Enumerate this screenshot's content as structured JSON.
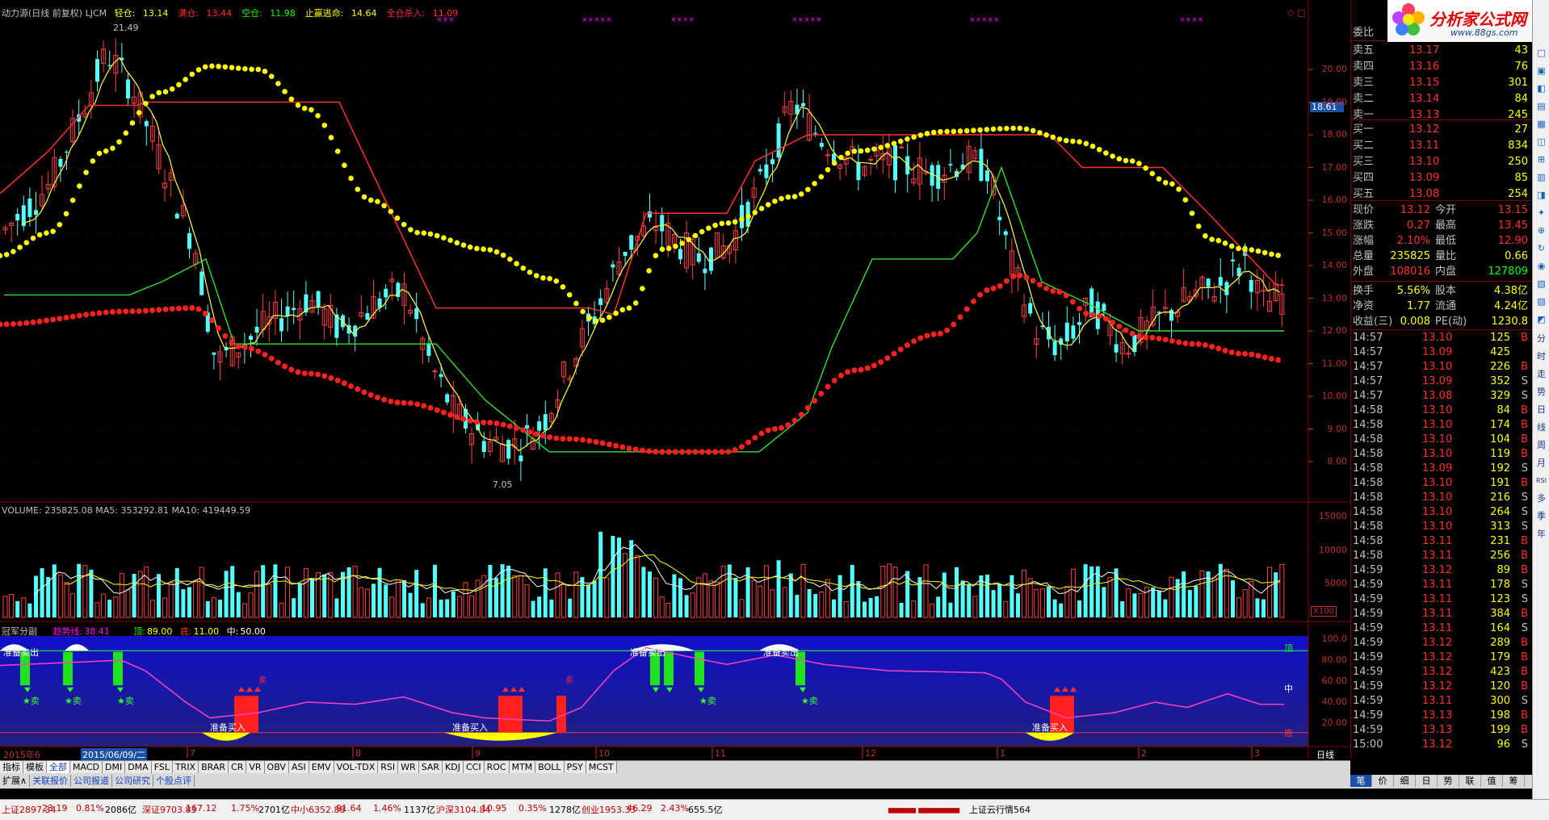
{
  "indicator_header": {
    "name": "动力源(日线 前复权) LJCM",
    "items": [
      {
        "label": "轻仓:",
        "value": "13.14",
        "color": "#ffff00"
      },
      {
        "label": "满仓:",
        "value": "13.44",
        "color": "#ff3030"
      },
      {
        "label": "空仓:",
        "value": "11.98",
        "color": "#00ff00"
      },
      {
        "label": "止赢逃命:",
        "value": "14.64",
        "color": "#ffff00"
      },
      {
        "label": "全仓杀入:",
        "value": "11.09",
        "color": "#ff3030"
      }
    ],
    "marks": [
      "×××",
      "×××××",
      "××××",
      "×××××",
      "×××××",
      "××××"
    ]
  },
  "price_chart": {
    "high_label": "21.49",
    "low_label": "7.05",
    "current_price_tag": "18.61",
    "y_ticks": [
      "20.00",
      "19.00",
      "18.00",
      "17.00",
      "16.00",
      "15.00",
      "14.00",
      "13.00",
      "12.00",
      "11.00",
      "10.00",
      "9.00",
      "8.00"
    ]
  },
  "volume_chart": {
    "header": "VOLUME: 235825.08 MA5: 353292.81 MA10: 419449.59",
    "y_ticks": [
      "15000",
      "10000",
      "5000"
    ],
    "unit": "X100"
  },
  "oscillator": {
    "name": "冠军分副",
    "trend_label": "趋势线:",
    "trend_value": "38.41",
    "top_label": "顶:",
    "top_value": "89.00",
    "bottom_label": "底:",
    "bottom_value": "11.00",
    "mid_label": "中:",
    "mid_value": "50.00",
    "y_ticks": [
      "100.0",
      "80.00",
      "60.00",
      "40.00",
      "20.00"
    ],
    "side_labels": {
      "top": "顶",
      "mid": "中",
      "bottom": "底"
    },
    "sell_prep": "准备卖出",
    "buy_prep": "准备买入",
    "sell": "卖",
    "sell_star": "★卖"
  },
  "time_axis": {
    "start": "2015年6",
    "selected_date": "2015/06/09/二",
    "months": [
      "7",
      "8",
      "9",
      "10",
      "11",
      "12",
      "1",
      "2",
      "3"
    ],
    "period": "日线"
  },
  "tabs_row1": [
    "指标",
    "模板",
    "全部",
    "MACD",
    "DMI",
    "DMA",
    "FSL",
    "TRIX",
    "BRAR",
    "CR",
    "VR",
    "OBV",
    "ASI",
    "EMV",
    "VOL-TDX",
    "RSI",
    "WR",
    "SAR",
    "KDJ",
    "CCI",
    "ROC",
    "MTM",
    "BOLL",
    "PSY",
    "MCST"
  ],
  "tabs_row1_active": "全部",
  "tabs_row2": [
    "扩展∧",
    "关联报价",
    "公司报道",
    "公司研究",
    "个股点评"
  ],
  "order_book": {
    "title": "委比",
    "asks": [
      {
        "label": "卖五",
        "price": "13.17",
        "vol": "43"
      },
      {
        "label": "卖四",
        "price": "13.16",
        "vol": "76"
      },
      {
        "label": "卖三",
        "price": "13.15",
        "vol": "301"
      },
      {
        "label": "卖二",
        "price": "13.14",
        "vol": "84"
      },
      {
        "label": "卖一",
        "price": "13.13",
        "vol": "245"
      }
    ],
    "bids": [
      {
        "label": "买一",
        "price": "13.12",
        "vol": "27"
      },
      {
        "label": "买二",
        "price": "13.11",
        "vol": "834"
      },
      {
        "label": "买三",
        "price": "13.10",
        "vol": "250"
      },
      {
        "label": "买四",
        "price": "13.09",
        "vol": "85"
      },
      {
        "label": "买五",
        "price": "13.08",
        "vol": "254"
      }
    ]
  },
  "stats": [
    {
      "l1": "现价",
      "v1": "13.12",
      "c1": "#ff3030",
      "l2": "今开",
      "v2": "13.15",
      "c2": "#ff3030"
    },
    {
      "l1": "涨跌",
      "v1": "0.27",
      "c1": "#ff3030",
      "l2": "最高",
      "v2": "13.45",
      "c2": "#ff3030"
    },
    {
      "l1": "涨幅",
      "v1": "2.10%",
      "c1": "#ff3030",
      "l2": "最低",
      "v2": "12.90",
      "c2": "#ff3030"
    },
    {
      "l1": "总量",
      "v1": "235825",
      "c1": "#ffff00",
      "l2": "量比",
      "v2": "0.66",
      "c2": "#ffff00"
    },
    {
      "l1": "外盘",
      "v1": "108016",
      "c1": "#ff3030",
      "l2": "内盘",
      "v2": "127809",
      "c2": "#00ff00"
    },
    {
      "l1": "换手",
      "v1": "5.56%",
      "c1": "#ffff00",
      "l2": "股本",
      "v2": "4.38亿",
      "c2": "#ffff00"
    },
    {
      "l1": "净资",
      "v1": "1.77",
      "c1": "#ffff00",
      "l2": "流通",
      "v2": "4.24亿",
      "c2": "#ffff00"
    },
    {
      "l1": "收益(三)",
      "v1": "0.008",
      "c1": "#ffff00",
      "l2": "PE(动)",
      "v2": "1230.8",
      "c2": "#ffff00"
    }
  ],
  "ticks": [
    {
      "t": "14:57",
      "p": "13.10",
      "v": "125",
      "bs": "B"
    },
    {
      "t": "14:57",
      "p": "13.09",
      "v": "425",
      "bs": ""
    },
    {
      "t": "14:57",
      "p": "13.10",
      "v": "226",
      "bs": "B"
    },
    {
      "t": "14:57",
      "p": "13.09",
      "v": "352",
      "bs": "S"
    },
    {
      "t": "14:57",
      "p": "13.08",
      "v": "329",
      "bs": "S"
    },
    {
      "t": "14:58",
      "p": "13.10",
      "v": "84",
      "bs": "B"
    },
    {
      "t": "14:58",
      "p": "13.10",
      "v": "174",
      "bs": "B"
    },
    {
      "t": "14:58",
      "p": "13.10",
      "v": "104",
      "bs": "B"
    },
    {
      "t": "14:58",
      "p": "13.10",
      "v": "119",
      "bs": "B"
    },
    {
      "t": "14:58",
      "p": "13.09",
      "v": "192",
      "bs": "S"
    },
    {
      "t": "14:58",
      "p": "13.10",
      "v": "191",
      "bs": "B"
    },
    {
      "t": "14:58",
      "p": "13.10",
      "v": "216",
      "bs": "S"
    },
    {
      "t": "14:58",
      "p": "13.10",
      "v": "264",
      "bs": "S"
    },
    {
      "t": "14:58",
      "p": "13.10",
      "v": "313",
      "bs": "S"
    },
    {
      "t": "14:58",
      "p": "13.11",
      "v": "231",
      "bs": "B"
    },
    {
      "t": "14:58",
      "p": "13.11",
      "v": "256",
      "bs": "B"
    },
    {
      "t": "14:59",
      "p": "13.12",
      "v": "89",
      "bs": "B"
    },
    {
      "t": "14:59",
      "p": "13.11",
      "v": "178",
      "bs": "S"
    },
    {
      "t": "14:59",
      "p": "13.11",
      "v": "123",
      "bs": "S"
    },
    {
      "t": "14:59",
      "p": "13.11",
      "v": "384",
      "bs": "B"
    },
    {
      "t": "14:59",
      "p": "13.11",
      "v": "164",
      "bs": "S"
    },
    {
      "t": "14:59",
      "p": "13.12",
      "v": "289",
      "bs": "B"
    },
    {
      "t": "14:59",
      "p": "13.12",
      "v": "179",
      "bs": "B"
    },
    {
      "t": "14:59",
      "p": "13.12",
      "v": "423",
      "bs": "B"
    },
    {
      "t": "14:59",
      "p": "13.12",
      "v": "120",
      "bs": "B"
    },
    {
      "t": "14:59",
      "p": "13.11",
      "v": "300",
      "bs": "S"
    },
    {
      "t": "14:59",
      "p": "13.13",
      "v": "198",
      "bs": "B"
    },
    {
      "t": "14:59",
      "p": "13.13",
      "v": "199",
      "bs": "B"
    },
    {
      "t": "15:00",
      "p": "13.12",
      "v": "96",
      "bs": "S"
    }
  ],
  "right_tabs": [
    "笔",
    "价",
    "细",
    "日",
    "势",
    "联",
    "值",
    "筹"
  ],
  "right_tabs_active": "笔",
  "sidebar": [
    "分",
    "时",
    "走",
    "势",
    "日",
    "线",
    "周",
    "月",
    "RSI",
    "多",
    "季",
    "年"
  ],
  "logo": {
    "name": "分析家公式网",
    "url": "www.88gs.com"
  },
  "statusbar": [
    {
      "text": "上证2897.34",
      "color": "#c00000"
    },
    {
      "text": "23.19",
      "color": "#c00000"
    },
    {
      "text": "0.81%",
      "color": "#c00000"
    },
    {
      "text": "2086亿",
      "color": "#000"
    },
    {
      "text": "深证9703.83",
      "color": "#c00000"
    },
    {
      "text": "167.12",
      "color": "#c00000"
    },
    {
      "text": "1.75%",
      "color": "#c00000"
    },
    {
      "text": "2701亿",
      "color": "#000"
    },
    {
      "text": "中小6352.88",
      "color": "#c00000"
    },
    {
      "text": "91.64",
      "color": "#c00000"
    },
    {
      "text": "1.46%",
      "color": "#c00000"
    },
    {
      "text": "1137亿",
      "color": "#000"
    },
    {
      "text": "沪深3104.84",
      "color": "#c00000"
    },
    {
      "text": "10.95",
      "color": "#c00000"
    },
    {
      "text": "0.35%",
      "color": "#c00000"
    },
    {
      "text": "1278亿",
      "color": "#000"
    },
    {
      "text": "创业1953.33",
      "color": "#c00000"
    },
    {
      "text": "46.29",
      "color": "#c00000"
    },
    {
      "text": "2.43%",
      "color": "#c00000"
    },
    {
      "text": "655.5亿",
      "color": "#000"
    },
    {
      "text": "上证云行情564",
      "color": "#000"
    }
  ]
}
